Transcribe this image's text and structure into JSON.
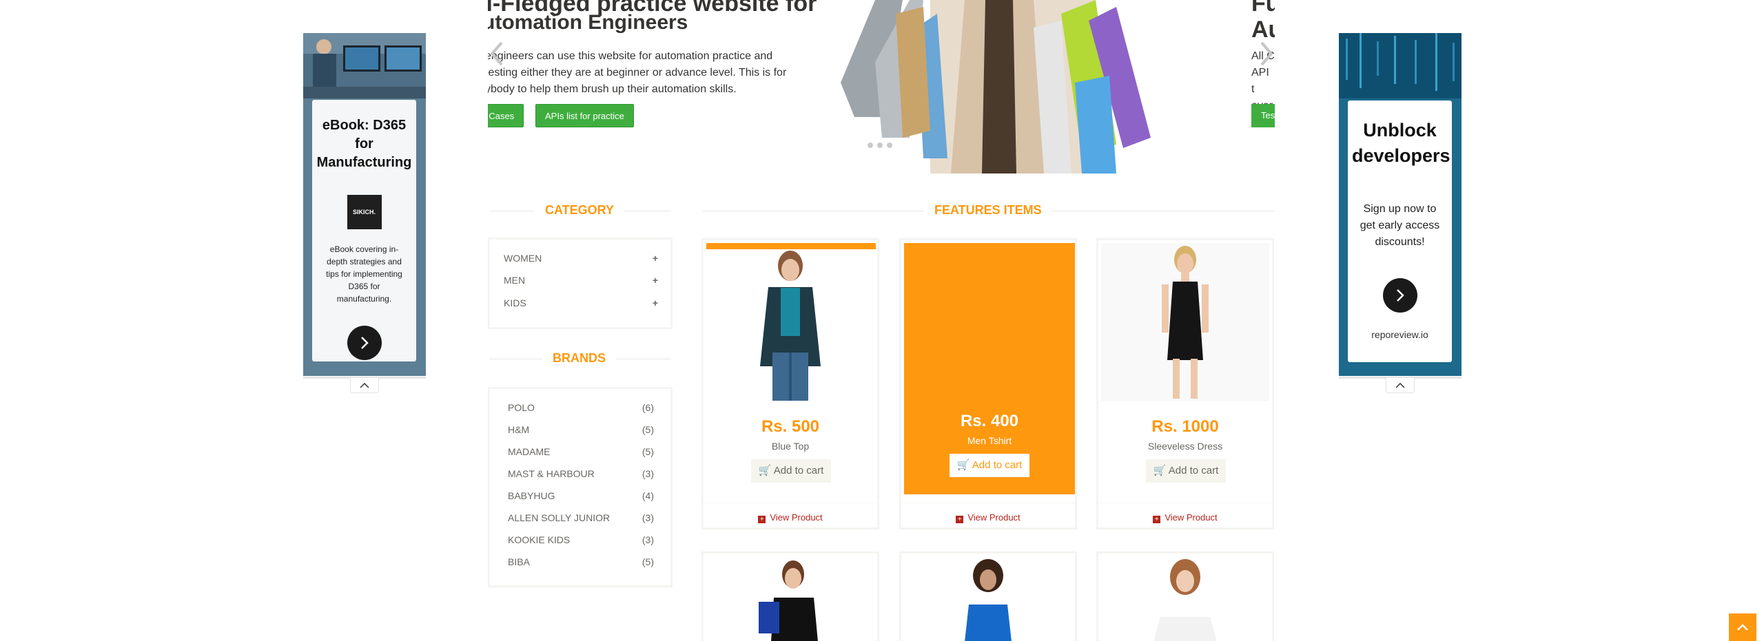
{
  "ads": {
    "left": {
      "title": "eBook: D365 for Manufacturing",
      "logo_text": "SIKICH.",
      "description": "eBook covering in-depth strategies and tips for implementing D365 for manufacturing.",
      "background": "#5d7f95"
    },
    "right": {
      "title": "Unblock developers",
      "description": "Sign up now to get early access discounts!",
      "domain": "reporeview.io",
      "background": "#1d6a8c"
    }
  },
  "slider": {
    "heading_line1": "ll-Fledged practice website for",
    "heading_line2": "utomation Engineers",
    "text": "engineers can use this website for automation practice and testing either they are at beginner or advance level. This is for ybody to help them brush up their automation skills.",
    "text_line1": "engineers can use this website for automation practice and",
    "text_line2": "testing either they are at beginner or advance level. This is for",
    "text_line3": "ybody to help them brush up their automation skills.",
    "button_test_cases": "t Cases",
    "button_apis": "APIs list for practice",
    "next_heading_line1": "Fu",
    "next_heading_line2": "Au",
    "next_text_line1": "All C",
    "next_text_line2": "API t",
    "next_text_line3": "ever",
    "next_button": "Tes"
  },
  "category": {
    "title": "CATEGORY",
    "items": [
      {
        "label": "WOMEN"
      },
      {
        "label": "MEN"
      },
      {
        "label": "KIDS"
      }
    ]
  },
  "brands": {
    "title": "BRANDS",
    "items": [
      {
        "name": "POLO",
        "count": "(6)"
      },
      {
        "name": "H&M",
        "count": "(5)"
      },
      {
        "name": "MADAME",
        "count": "(5)"
      },
      {
        "name": "MAST & HARBOUR",
        "count": "(3)"
      },
      {
        "name": "BABYHUG",
        "count": "(4)"
      },
      {
        "name": "ALLEN SOLLY JUNIOR",
        "count": "(3)"
      },
      {
        "name": "KOOKIE KIDS",
        "count": "(3)"
      },
      {
        "name": "BIBA",
        "count": "(5)"
      }
    ]
  },
  "features": {
    "title": "FEATURES ITEMS",
    "products": [
      {
        "price": "Rs. 500",
        "name": "Blue Top",
        "add_to_cart": "Add to cart",
        "view": "View Product"
      },
      {
        "price": "Rs. 400",
        "name": "Men Tshirt",
        "add_to_cart": "Add to cart",
        "view": "View Product"
      },
      {
        "price": "Rs. 1000",
        "name": "Sleeveless Dress",
        "add_to_cart": "Add to cart",
        "view": "View Product"
      }
    ]
  },
  "colors": {
    "accent": "#fe980f",
    "button_green": "#3fae3f",
    "link_red": "#b4261d"
  }
}
